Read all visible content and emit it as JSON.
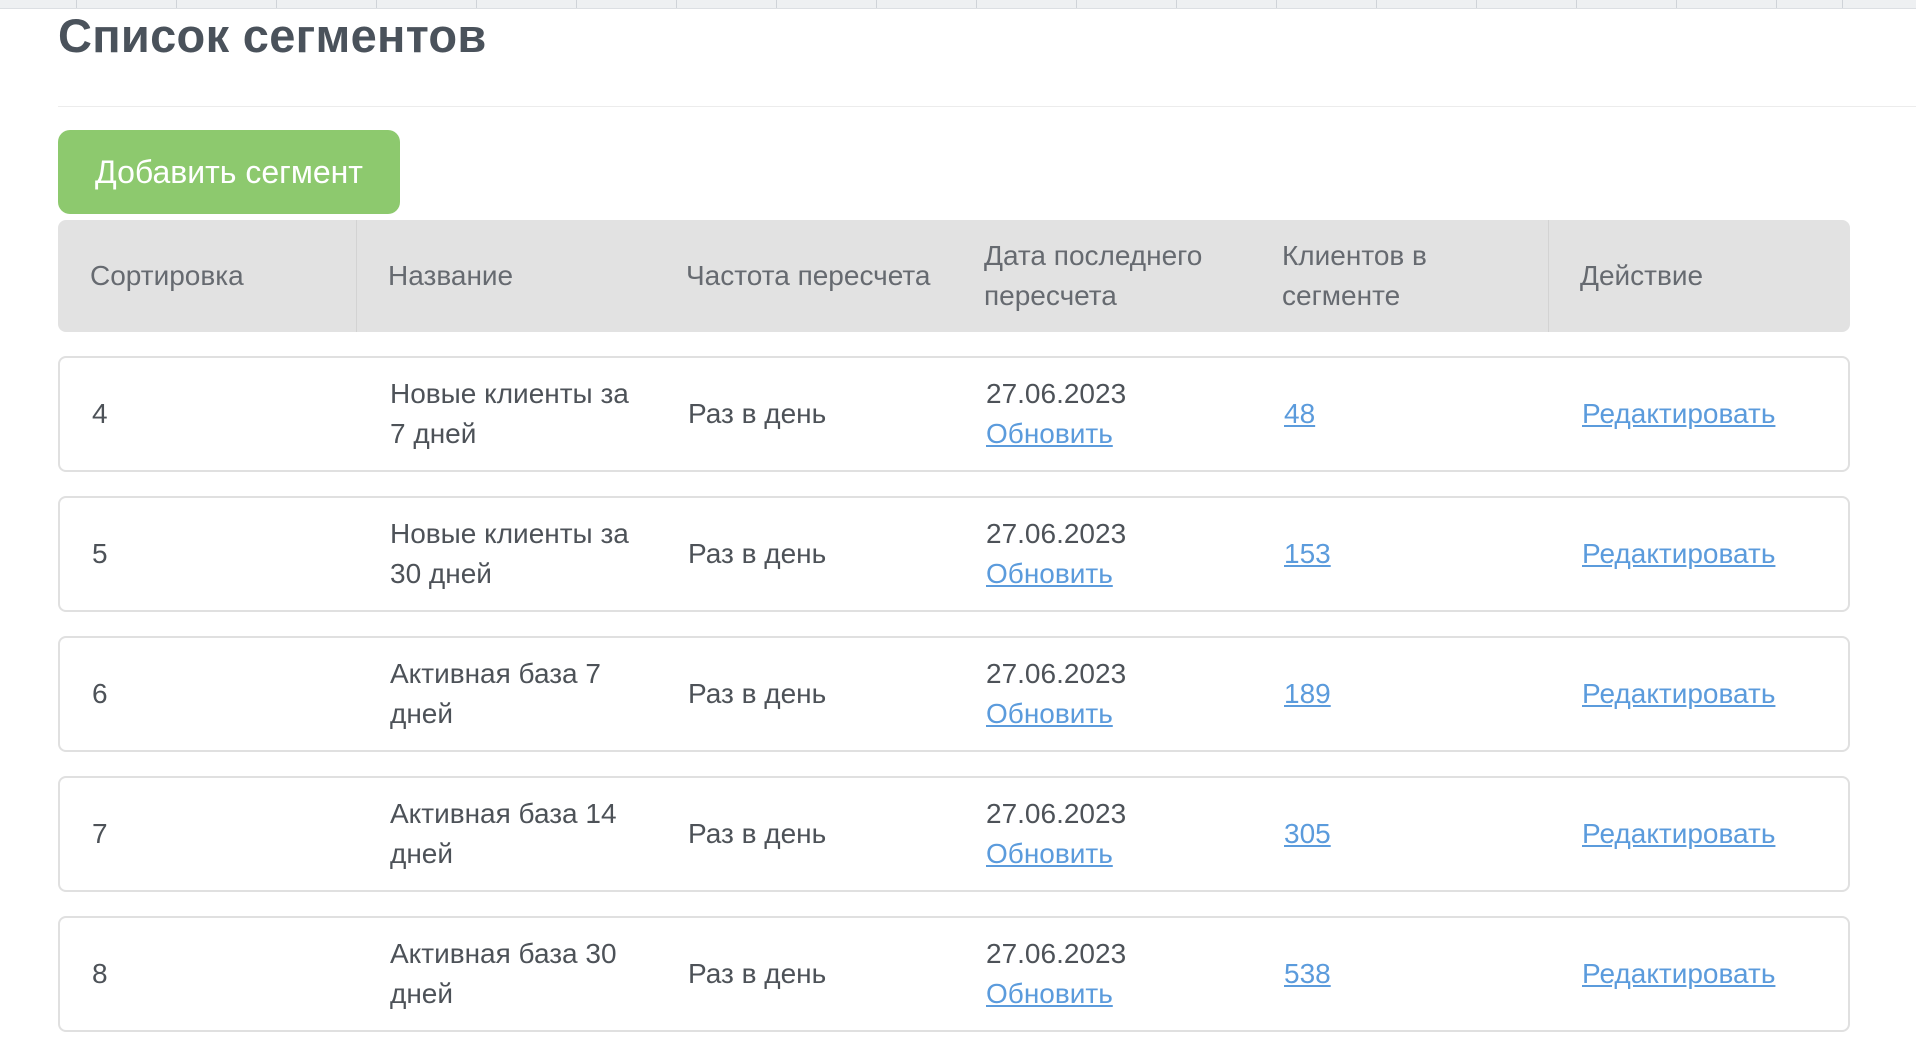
{
  "page": {
    "title": "Список сегментов"
  },
  "toolbar": {
    "add_label": "Добавить сегмент"
  },
  "table": {
    "headers": {
      "sort": "Сортировка",
      "name": "Название",
      "frequency": "Частота пересчета",
      "last_date": "Дата последнего пересчета",
      "clients": "Клиентов в сегменте",
      "action": "Действие"
    },
    "rows": [
      {
        "sort": "4",
        "name": "Новые клиенты за 7 дней",
        "frequency": "Раз в день",
        "date": "27.06.2023",
        "refresh": "Обновить",
        "clients": "48",
        "action": "Редактировать"
      },
      {
        "sort": "5",
        "name": "Новые клиенты за 30 дней",
        "frequency": "Раз в день",
        "date": "27.06.2023",
        "refresh": "Обновить",
        "clients": "153",
        "action": "Редактировать"
      },
      {
        "sort": "6",
        "name": "Активная база 7 дней",
        "frequency": "Раз в день",
        "date": "27.06.2023",
        "refresh": "Обновить",
        "clients": "189",
        "action": "Редактировать"
      },
      {
        "sort": "7",
        "name": "Активная база 14 дней",
        "frequency": "Раз в день",
        "date": "27.06.2023",
        "refresh": "Обновить",
        "clients": "305",
        "action": "Редактировать"
      },
      {
        "sort": "8",
        "name": "Активная база 30 дней",
        "frequency": "Раз в день",
        "date": "27.06.2023",
        "refresh": "Обновить",
        "clients": "538",
        "action": "Редактировать"
      }
    ]
  },
  "colors": {
    "accent_button": "#8dc96e",
    "link": "#5b9bdc",
    "header_bg": "#e2e2e2"
  }
}
